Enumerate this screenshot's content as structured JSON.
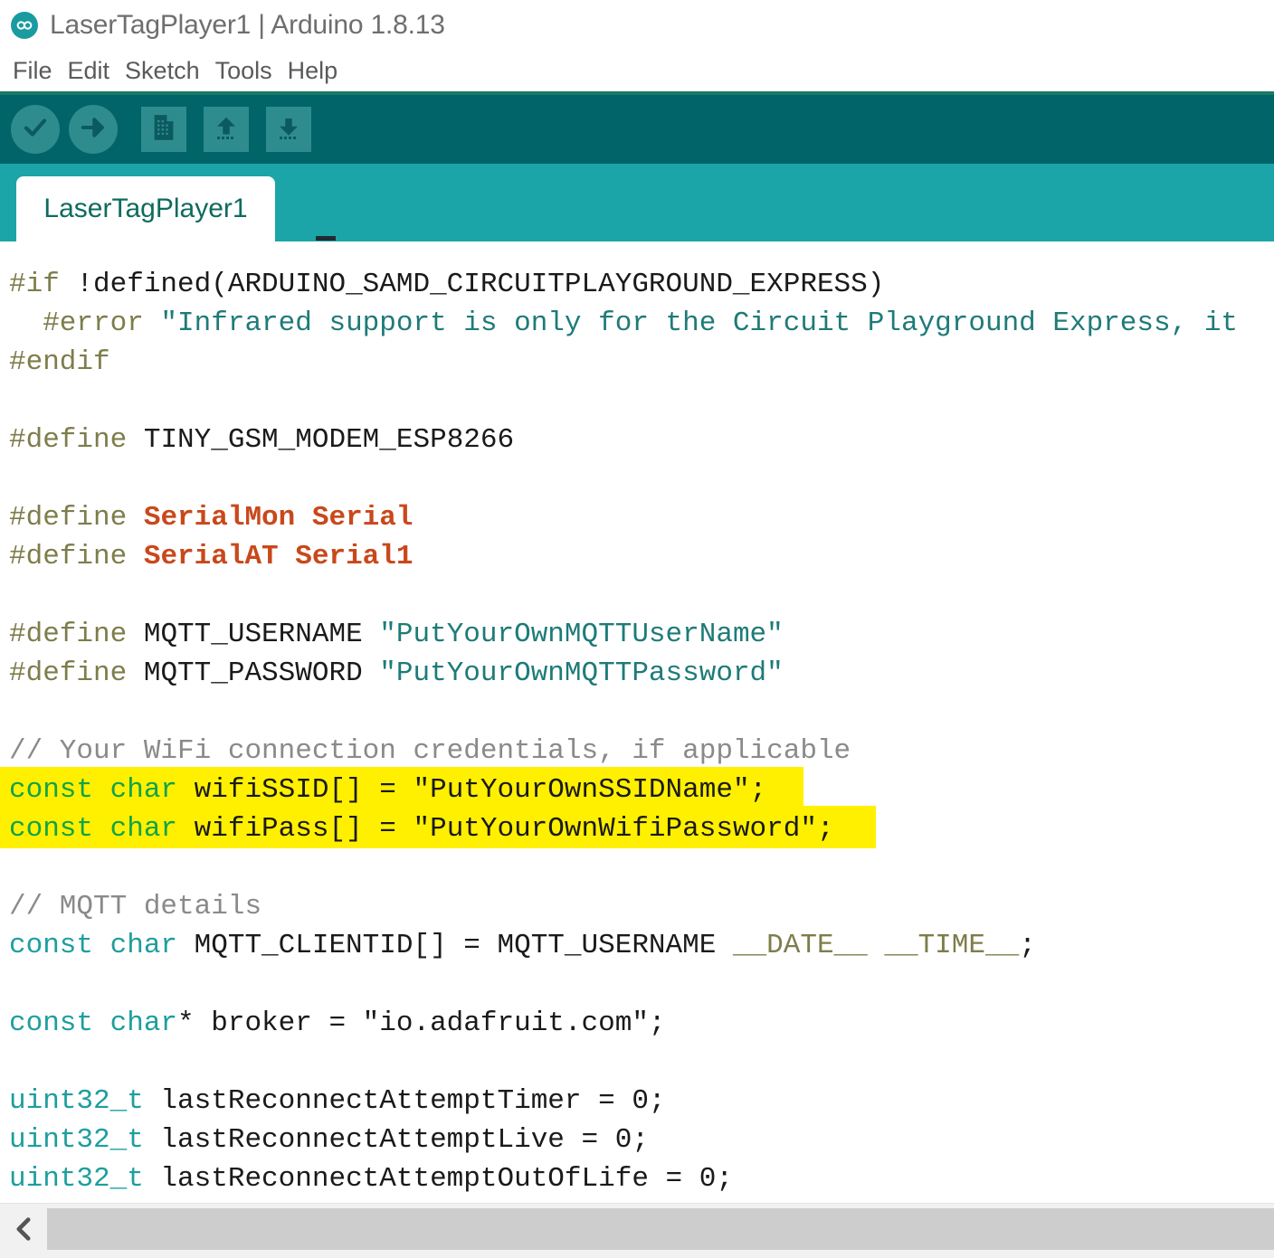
{
  "window": {
    "title": "LaserTagPlayer1 | Arduino 1.8.13",
    "logo_icon": "arduino-infinity-logo"
  },
  "menubar": {
    "items": [
      {
        "label": "File"
      },
      {
        "label": "Edit"
      },
      {
        "label": "Sketch"
      },
      {
        "label": "Tools"
      },
      {
        "label": "Help"
      }
    ]
  },
  "toolbar": {
    "buttons": [
      {
        "name": "verify",
        "icon": "check-icon",
        "tooltip": "Verify"
      },
      {
        "name": "upload",
        "icon": "arrow-right-icon",
        "tooltip": "Upload"
      },
      {
        "name": "new",
        "icon": "new-document-icon",
        "tooltip": "New"
      },
      {
        "name": "open",
        "icon": "arrow-up-icon",
        "tooltip": "Open"
      },
      {
        "name": "save",
        "icon": "arrow-down-icon",
        "tooltip": "Save"
      }
    ]
  },
  "tabs": {
    "active_index": 0,
    "items": [
      {
        "label": "LaserTagPlayer1"
      }
    ]
  },
  "colors": {
    "toolbar_bg": "#006468",
    "tabbar_bg": "#1BA5A8",
    "tab_active_bg": "#ffffff",
    "tab_active_text": "#0E6B5E",
    "menu_underline": "#1a7a62",
    "highlight_marker": "#FFF000",
    "preprocessor": "#7E7D4B",
    "string": "#1E7B78",
    "comment": "#8a8a8a",
    "keyword": "#1E9E9E",
    "keyword_green": "#12A348",
    "literal_define": "#C9481B"
  },
  "editor": {
    "lines": [
      {
        "n": 1,
        "tokens": [
          {
            "c": "t-pre",
            "t": "#if"
          },
          {
            "c": "t-plain",
            "t": " !defined(ARDUINO_SAMD_CIRCUITPLAYGROUND_EXPRESS)"
          }
        ]
      },
      {
        "n": 2,
        "tokens": [
          {
            "c": "t-pre",
            "t": "  #error"
          },
          {
            "c": "t-str",
            "t": " \"Infrared support is only for the Circuit Playground Express, it"
          }
        ]
      },
      {
        "n": 3,
        "tokens": [
          {
            "c": "t-pre",
            "t": "#endif"
          }
        ]
      },
      {
        "n": 4,
        "tokens": []
      },
      {
        "n": 5,
        "tokens": [
          {
            "c": "t-pre",
            "t": "#define"
          },
          {
            "c": "t-plain",
            "t": " TINY_GSM_MODEM_ESP8266"
          }
        ]
      },
      {
        "n": 6,
        "tokens": []
      },
      {
        "n": 7,
        "tokens": [
          {
            "c": "t-pre",
            "t": "#define"
          },
          {
            "c": "t-lit",
            "t": " SerialMon Serial"
          }
        ]
      },
      {
        "n": 8,
        "tokens": [
          {
            "c": "t-pre",
            "t": "#define"
          },
          {
            "c": "t-lit",
            "t": " SerialAT Serial1"
          }
        ]
      },
      {
        "n": 9,
        "tokens": []
      },
      {
        "n": 10,
        "tokens": [
          {
            "c": "t-pre",
            "t": "#define"
          },
          {
            "c": "t-plain",
            "t": " MQTT_USERNAME "
          },
          {
            "c": "t-str",
            "t": "\"PutYourOwnMQTTUserName\""
          }
        ]
      },
      {
        "n": 11,
        "tokens": [
          {
            "c": "t-pre",
            "t": "#define"
          },
          {
            "c": "t-plain",
            "t": " MQTT_PASSWORD "
          },
          {
            "c": "t-str",
            "t": "\"PutYourOwnMQTTPassword\""
          }
        ]
      },
      {
        "n": 12,
        "tokens": []
      },
      {
        "n": 13,
        "tokens": [
          {
            "c": "t-cmt",
            "t": "// Your WiFi connection credentials, if applicable"
          }
        ]
      },
      {
        "n": 14,
        "highlight": true,
        "hl_width": 878,
        "tokens": [
          {
            "c": "t-kwg",
            "t": "const char"
          },
          {
            "c": "t-plain",
            "t": " wifiSSID[] = "
          },
          {
            "c": "t-plain",
            "t": "\"PutYourOwnSSIDName\";"
          }
        ]
      },
      {
        "n": 15,
        "highlight": true,
        "hl_width": 958,
        "tokens": [
          {
            "c": "t-kwg",
            "t": "const char"
          },
          {
            "c": "t-plain",
            "t": " wifiPass[] = "
          },
          {
            "c": "t-plain",
            "t": "\"PutYourOwnWifiPassword\";"
          }
        ]
      },
      {
        "n": 16,
        "tokens": []
      },
      {
        "n": 17,
        "tokens": [
          {
            "c": "t-cmt",
            "t": "// MQTT details"
          }
        ]
      },
      {
        "n": 18,
        "tokens": [
          {
            "c": "t-kw",
            "t": "const char"
          },
          {
            "c": "t-plain",
            "t": " MQTT_CLIENTID[] = MQTT_USERNAME "
          },
          {
            "c": "t-pre",
            "t": "__DATE__ __TIME__"
          },
          {
            "c": "t-plain",
            "t": ";"
          }
        ]
      },
      {
        "n": 19,
        "tokens": []
      },
      {
        "n": 20,
        "tokens": [
          {
            "c": "t-kw",
            "t": "const char"
          },
          {
            "c": "t-plain",
            "t": "* broker = "
          },
          {
            "c": "t-plain",
            "t": "\"io.adafruit.com\";"
          }
        ]
      },
      {
        "n": 21,
        "tokens": []
      },
      {
        "n": 22,
        "tokens": [
          {
            "c": "t-kw",
            "t": "uint32_t"
          },
          {
            "c": "t-plain",
            "t": " lastReconnectAttemptTimer = 0;"
          }
        ]
      },
      {
        "n": 23,
        "tokens": [
          {
            "c": "t-kw",
            "t": "uint32_t"
          },
          {
            "c": "t-plain",
            "t": " lastReconnectAttemptLive = 0;"
          }
        ]
      },
      {
        "n": 24,
        "tokens": [
          {
            "c": "t-kw",
            "t": "uint32_t"
          },
          {
            "c": "t-plain",
            "t": " lastReconnectAttemptOutOfLife = 0;"
          }
        ]
      }
    ]
  },
  "scrollbar": {
    "left_button_icon": "chevron-left-icon",
    "orientation": "horizontal"
  }
}
